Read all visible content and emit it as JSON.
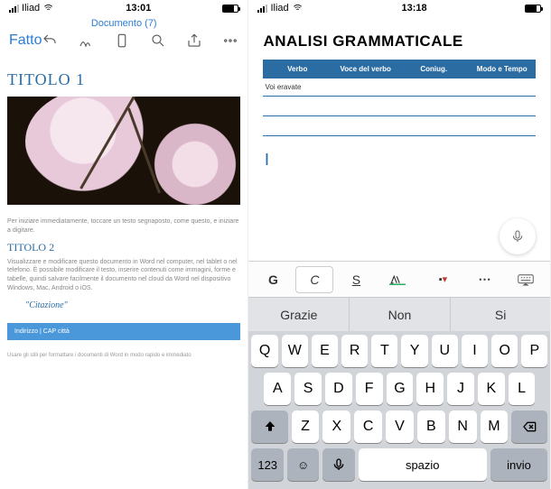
{
  "left": {
    "status": {
      "carrier": "Iliad",
      "time": "13:01"
    },
    "doc_title": "Documento (7)",
    "done": "Fatto",
    "doc": {
      "h1": "TITOLO 1",
      "p1": "Per iniziare immediatamente, toccare un testo segnaposto, come questo, e iniziare a digitare.",
      "h2": "TITOLO 2",
      "p2": "Visualizzare e modificare questo documento in Word nel computer, nel tablet o nel telefono. È possibile modificare il testo, inserire contenuti come immagini, forme e tabelle, quindi salvare facilmente il documento nel cloud da Word nel dispositivo Windows, Mac, Android o iOS.",
      "quote": "\"Citazione\"",
      "address": "Indirizzo | CAP città",
      "footer": "Usare gli stili per formattare i documenti di Word in modo rapido e immediato"
    }
  },
  "right": {
    "status": {
      "carrier": "Iliad",
      "time": "13:18"
    },
    "title": "ANALISI GRAMMATICALE",
    "columns": [
      "Verbo",
      "Voce del verbo",
      "Coniug.",
      "Modo e Tempo"
    ],
    "row1": [
      "Voi eravate",
      "",
      "",
      ""
    ],
    "fmt": {
      "bold": "G",
      "italic": "C",
      "underline": "S"
    },
    "suggestions": [
      "Grazie",
      "Non",
      "Si"
    ],
    "keyboard": {
      "r1": [
        "Q",
        "W",
        "E",
        "R",
        "T",
        "Y",
        "U",
        "I",
        "O",
        "P"
      ],
      "r2": [
        "A",
        "S",
        "D",
        "F",
        "G",
        "H",
        "J",
        "K",
        "L"
      ],
      "r3": [
        "Z",
        "X",
        "C",
        "V",
        "B",
        "N",
        "M"
      ],
      "fn": {
        "num": "123",
        "space": "spazio",
        "enter": "invio"
      }
    }
  }
}
